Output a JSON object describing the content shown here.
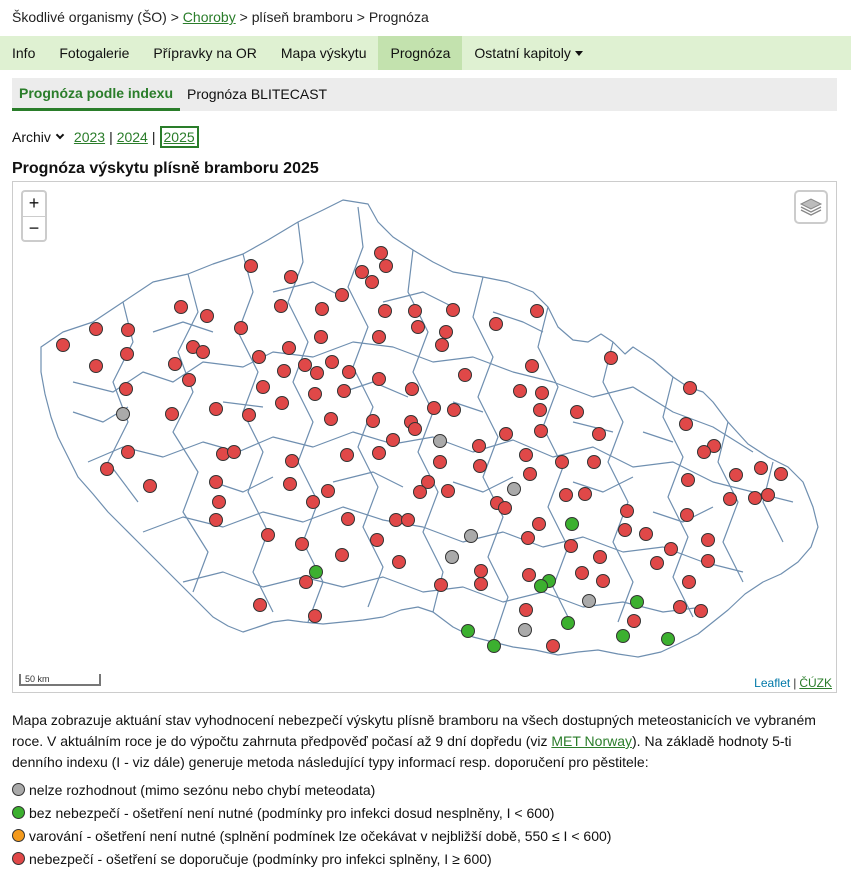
{
  "breadcrumb": {
    "root": "Škodlivé organismy (ŠO)",
    "sep": ">",
    "link": "Choroby",
    "item": "plíseň bramboru",
    "current": "Prognóza"
  },
  "nav": {
    "items": [
      "Info",
      "Fotogalerie",
      "Přípravky na OR",
      "Mapa výskytu",
      "Prognóza",
      "Ostatní kapitoly"
    ],
    "active_index": 4
  },
  "subnav": {
    "items": [
      "Prognóza podle indexu",
      "Prognóza BLITECAST"
    ],
    "active_index": 0
  },
  "archive": {
    "label": "Archiv",
    "years": [
      "2023",
      "2024",
      "2025"
    ],
    "sep": "|",
    "current": "2025"
  },
  "map": {
    "title": "Prognóza výskytu plísně bramboru 2025",
    "zoom_in": "+",
    "zoom_out": "−",
    "scale_label": "50 km",
    "attribution_leaflet": "Leaflet",
    "attribution_sep": "|",
    "attribution_cuzk": "ČÚZK"
  },
  "description": {
    "part1": "Mapa zobrazuje aktuání stav vyhodnocení nebezpečí výskytu plísně bramboru na všech dostupných meteostanicích ve vybraném roce. V aktuálním roce je do výpočtu zahrnuta předpověď počasí až 9 dní dopředu (viz ",
    "link": "MET Norway",
    "part2": "). Na základě hodnoty 5-ti denního indexu (I - viz dále) generuje metoda následující typy informací resp. doporučení pro pěstitele:"
  },
  "legend": [
    {
      "color": "#aaaaaa",
      "text": "nelze rozhodnout (mimo sezónu nebo chybí meteodata)"
    },
    {
      "color": "#3cb02f",
      "text": "bez nebezpečí - ošetření není nutné (podmínky pro infekci dosud nesplněny, I < 600)"
    },
    {
      "color": "#f39a1d",
      "text": "varování - ošetření není nutné (splnění podmínek lze očekávat v nejbližší době, 550 ≤ I < 600)"
    },
    {
      "color": "#e04848",
      "text": "nebezpečí - ošetření se doporučuje (podmínky pro infekci splněny, I ≥ 600)"
    }
  ]
}
